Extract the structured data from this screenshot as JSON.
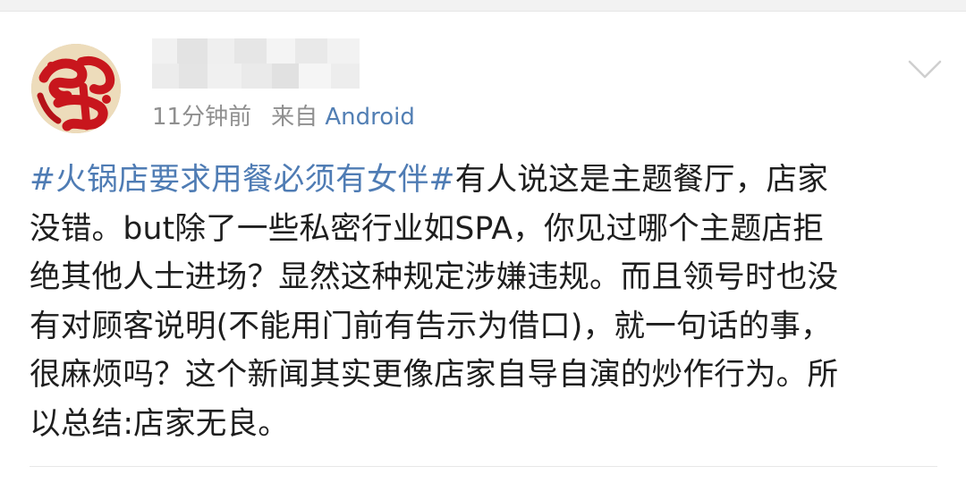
{
  "post": {
    "author": {
      "name": "",
      "avatar_icon": "fu-character-avatar"
    },
    "meta": {
      "time": "11分钟前",
      "source_prefix": "来自",
      "source": "Android"
    },
    "menu_icon": "chevron-down-icon",
    "body_lines": [
      {
        "topic": "#火锅店要求用餐必须有女伴#",
        "text": "有人说这是主题餐厅，店家"
      },
      {
        "text": "没错。but除了一些私密行业如SPA，你见过哪个主题店拒"
      },
      {
        "text": "绝其他人士进场？显然这种规定涉嫌违规。而且领号时也没"
      },
      {
        "text": "有对顾客说明(不能用门前有告示为借口)，就一句话的事，"
      },
      {
        "text": "很麻烦吗？这个新闻其实更像店家自导自演的炒作行为。所"
      },
      {
        "text": "以总结:店家无良。"
      }
    ]
  },
  "colors": {
    "topic": "#4f7cb4",
    "source": "#527fb4",
    "meta": "#8f8f8f",
    "text": "#1e1e1e"
  }
}
